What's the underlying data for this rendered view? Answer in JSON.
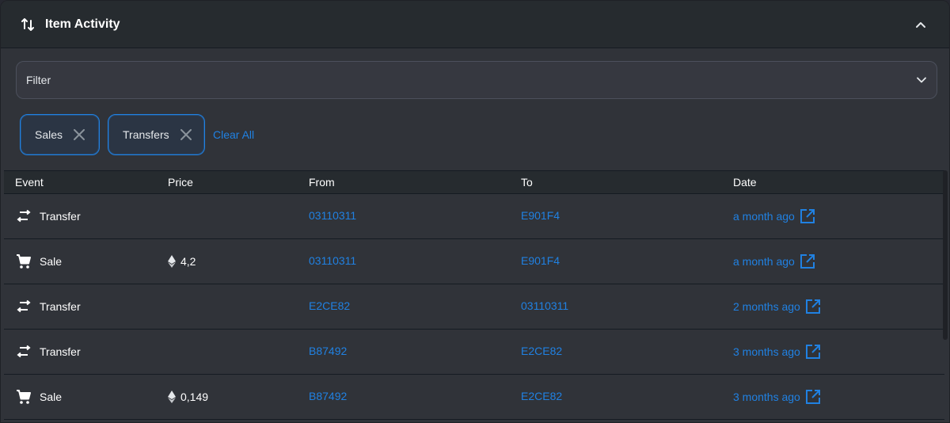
{
  "header": {
    "title": "Item Activity"
  },
  "filter": {
    "label": "Filter"
  },
  "chips": [
    {
      "label": "Sales"
    },
    {
      "label": "Transfers"
    }
  ],
  "clear_all": "Clear All",
  "table": {
    "columns": [
      "Event",
      "Price",
      "From",
      "To",
      "Date"
    ],
    "rows": [
      {
        "event": "Transfer",
        "event_icon": "transfer-icon",
        "price": "",
        "from": "03110311",
        "to": "E901F4",
        "date": "a month ago"
      },
      {
        "event": "Sale",
        "event_icon": "cart-icon",
        "price": "4,2",
        "from": "03110311",
        "to": "E901F4",
        "date": "a month ago"
      },
      {
        "event": "Transfer",
        "event_icon": "transfer-icon",
        "price": "",
        "from": "E2CE82",
        "to": "03110311",
        "date": "2 months ago"
      },
      {
        "event": "Transfer",
        "event_icon": "transfer-icon",
        "price": "",
        "from": "B87492",
        "to": "E2CE82",
        "date": "3 months ago"
      },
      {
        "event": "Sale",
        "event_icon": "cart-icon",
        "price": "0,149",
        "from": "B87492",
        "to": "E2CE82",
        "date": "3 months ago"
      }
    ]
  },
  "colors": {
    "accent": "#2081e2",
    "background": "#303339",
    "header": "#262b2f"
  }
}
